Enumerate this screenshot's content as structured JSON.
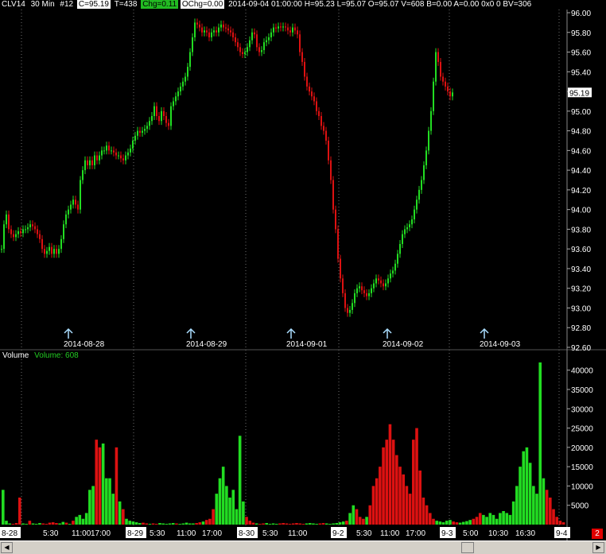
{
  "header": {
    "symbol": "CLV14",
    "interval": "30 Min",
    "id": "#12",
    "close": "C=95.19",
    "ticks": "T=438",
    "chg": "Chg=0.11",
    "ochg": "OChg=0.00",
    "ohlc": "2014-09-04 01:00:00 H=95.23 L=95.07 O=95.07 V=608 B=0.00 A=0.00 0x0 0 BV=306"
  },
  "volume_label": "Volume",
  "volume_value": "Volume: 608",
  "last_price_tag": "95.19",
  "badge": "2",
  "colors": {
    "up": "#22dd22",
    "down": "#dd1111",
    "grid": "#707070",
    "axis_text": "#ffffff",
    "marker": "#aaddff"
  },
  "icons": {
    "scroll_left": "left-arrow-icon",
    "scroll_right": "right-arrow-icon"
  },
  "chart_data": [
    {
      "type": "line",
      "title": "",
      "ylim": [
        92.6,
        96.0
      ],
      "y_ticks": [
        "96.00",
        "95.80",
        "95.60",
        "95.40",
        "95.20",
        "95.00",
        "94.80",
        "94.60",
        "94.40",
        "94.20",
        "94.00",
        "93.80",
        "93.60",
        "93.40",
        "93.20",
        "93.00",
        "92.80",
        "92.60"
      ],
      "session_markers": [
        "2014-08-28",
        "2014-08-29",
        "2014-09-01",
        "2014-09-02",
        "2014-09-03"
      ],
      "x": [
        0,
        3,
        6,
        9,
        12,
        15,
        18,
        21,
        24,
        27,
        30,
        33,
        36,
        39,
        42,
        45,
        48,
        51,
        54,
        57,
        60,
        63,
        66,
        69,
        72,
        75,
        78,
        81,
        84,
        87,
        90,
        93,
        96,
        99,
        102,
        105,
        108,
        111,
        114,
        117,
        120,
        123,
        126,
        129,
        132,
        135,
        138,
        141,
        144,
        147,
        150,
        153,
        156,
        159,
        162,
        165,
        168,
        171,
        174,
        177,
        180,
        183,
        186,
        189,
        192,
        195,
        198,
        201,
        204,
        207,
        210,
        213,
        216,
        219,
        222,
        225,
        228,
        231,
        234,
        237,
        240,
        243,
        246,
        249,
        252,
        255,
        258,
        261,
        264,
        267,
        270,
        273,
        276,
        279,
        282,
        285,
        288,
        291,
        294,
        297,
        300,
        303,
        306,
        309,
        312,
        315,
        318,
        321,
        324,
        327,
        330,
        333,
        336,
        339,
        342,
        345,
        348,
        351,
        354,
        357,
        360,
        363,
        366,
        369,
        372,
        375,
        378,
        381,
        384,
        387,
        390,
        393,
        396,
        399,
        402,
        405,
        408,
        411,
        414,
        417,
        420,
        423,
        426,
        429,
        432,
        435,
        438,
        441,
        444,
        447,
        450,
        453,
        456,
        459,
        462,
        465,
        468,
        471,
        474,
        477,
        480,
        483,
        486,
        489,
        492,
        495,
        498,
        501,
        504,
        507,
        510,
        513,
        516,
        519,
        522,
        525,
        528,
        531,
        534,
        537,
        540,
        543,
        546,
        549,
        552,
        555,
        558,
        561,
        564,
        567,
        570,
        573,
        576,
        579,
        582,
        585,
        588,
        591,
        594,
        597,
        600,
        603,
        606,
        609,
        612,
        615,
        618,
        621,
        624,
        627,
        630,
        633,
        636,
        639,
        642,
        645,
        648,
        651,
        654,
        657,
        660,
        663,
        666,
        669,
        672,
        675,
        678,
        681,
        684,
        687,
        690,
        693,
        696,
        699,
        702,
        705,
        708
      ],
      "series": [
        {
          "name": "",
          "values": [
            93.6,
            93.85,
            93.95,
            93.8,
            93.75,
            93.72,
            93.75,
            93.78,
            93.76,
            93.8,
            93.8,
            93.82,
            93.85,
            93.83,
            93.8,
            93.75,
            93.7,
            93.6,
            93.55,
            93.58,
            93.62,
            93.55,
            93.6,
            93.55,
            93.6,
            93.7,
            93.85,
            93.95,
            94.0,
            94.05,
            94.1,
            94.05,
            94.0,
            94.3,
            94.4,
            94.5,
            94.45,
            94.5,
            94.45,
            94.55,
            94.5,
            94.55,
            94.6,
            94.6,
            94.65,
            94.6,
            94.6,
            94.58,
            94.55,
            94.55,
            94.52,
            94.5,
            94.55,
            94.58,
            94.62,
            94.7,
            94.75,
            94.8,
            94.78,
            94.8,
            94.82,
            94.85,
            94.9,
            94.95,
            95.05,
            94.95,
            94.9,
            95.0,
            94.95,
            94.88,
            94.85,
            95.05,
            95.1,
            95.15,
            95.2,
            95.25,
            95.3,
            95.35,
            95.45,
            95.6,
            95.75,
            95.9,
            95.88,
            95.85,
            95.8,
            95.82,
            95.8,
            95.75,
            95.8,
            95.82,
            95.8,
            95.85,
            95.88,
            95.85,
            95.84,
            95.82,
            95.8,
            95.75,
            95.7,
            95.65,
            95.6,
            95.58,
            95.6,
            95.65,
            95.72,
            95.8,
            95.78,
            95.65,
            95.6,
            95.62,
            95.7,
            95.72,
            95.75,
            95.8,
            95.85,
            95.84,
            95.86,
            95.85,
            95.86,
            95.85,
            95.82,
            95.8,
            95.85,
            95.82,
            95.78,
            95.6,
            95.5,
            95.35,
            95.25,
            95.2,
            95.15,
            95.1,
            95.0,
            94.95,
            94.85,
            94.8,
            94.7,
            94.5,
            94.3,
            94.0,
            93.8,
            93.5,
            93.3,
            93.15,
            93.0,
            92.95,
            92.98,
            93.05,
            93.15,
            93.2,
            93.22,
            93.18,
            93.15,
            93.12,
            93.15,
            93.2,
            93.25,
            93.3,
            93.28,
            93.25,
            93.22,
            93.25,
            93.3,
            93.35,
            93.38,
            93.45,
            93.55,
            93.65,
            93.75,
            93.8,
            93.82,
            93.85,
            93.9,
            94.0,
            94.1,
            94.2,
            94.3,
            94.45,
            94.6,
            94.8,
            95.0,
            95.3,
            95.6,
            95.5,
            95.35,
            95.3,
            95.25,
            95.2,
            95.15,
            95.19
          ]
        }
      ]
    },
    {
      "type": "bar",
      "title": "",
      "ylim": [
        0,
        42000
      ],
      "y_ticks": [
        "40000",
        "35000",
        "30000",
        "25000",
        "20000",
        "15000",
        "10000",
        "5000"
      ],
      "x_ticks": [
        "8-28",
        "5:30",
        "11:00",
        "17:00",
        "8-29",
        "5:30",
        "11:00",
        "17:00",
        "8-30",
        "5:30",
        "11:00",
        "9-2",
        "5:30",
        "11:00",
        "17:00",
        "9-3",
        "5:00",
        "10:30",
        "16:30",
        "9-4"
      ],
      "values": [
        9000,
        1000,
        300,
        200,
        400,
        7000,
        300,
        200,
        1000,
        300,
        200,
        400,
        300,
        200,
        500,
        600,
        400,
        300,
        700,
        500,
        200,
        1000,
        2000,
        2500,
        1500,
        3000,
        9000,
        10000,
        22000,
        20000,
        21000,
        12000,
        12000,
        8000,
        20000,
        6000,
        4000,
        1500,
        1000,
        800,
        600,
        400,
        500,
        300,
        200,
        300,
        200,
        400,
        300,
        200,
        300,
        400,
        300,
        200,
        300,
        500,
        300,
        300,
        400,
        600,
        800,
        1200,
        1500,
        4000,
        8000,
        12000,
        15000,
        10000,
        7000,
        9000,
        4000,
        23000,
        6000,
        2000,
        1000,
        500,
        300,
        200,
        300,
        400,
        200,
        300,
        200,
        300,
        400,
        300,
        200,
        300,
        400,
        300,
        200,
        300,
        400,
        300,
        200,
        300,
        400,
        300,
        200,
        300,
        400,
        600,
        800,
        1000,
        3000,
        5000,
        4000,
        2000,
        1500,
        2000,
        5000,
        10000,
        12000,
        15000,
        20000,
        22000,
        26000,
        22000,
        18000,
        15000,
        13000,
        10000,
        8000,
        22000,
        25000,
        14000,
        7000,
        5000,
        3000,
        1500,
        1000,
        800,
        600,
        1000,
        1200,
        800,
        600,
        500,
        700,
        900,
        1200,
        1500,
        2000,
        3000,
        2500,
        2000,
        3000,
        2500,
        1500,
        3000,
        3500,
        3000,
        2500,
        6000,
        10000,
        15000,
        19000,
        20000,
        16000,
        10000,
        8000,
        42000,
        12000,
        9000,
        7000,
        4000,
        2000,
        1000,
        600
      ],
      "value_colors_pattern": "up/down follows price candle direction"
    }
  ]
}
